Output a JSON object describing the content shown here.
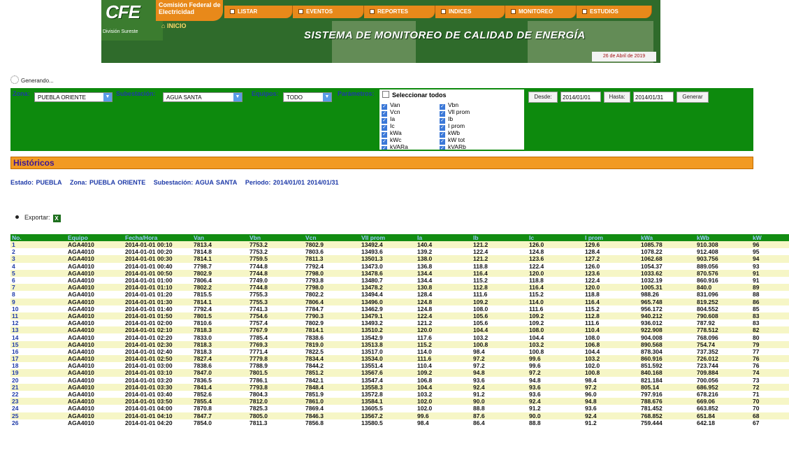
{
  "header": {
    "logo": "CFE",
    "org_name": "Comisión Federal de Electricidad",
    "division": "División Sureste",
    "home_link": "INICIO",
    "nav": [
      "LISTAR",
      "EVENTOS",
      "REPORTES",
      "INDICES",
      "MONITOREO",
      "ESTUDIOS"
    ],
    "title": "SISTEMA DE MONITOREO DE CALIDAD DE ENERGÍA",
    "date": "26 de Abril de 2019"
  },
  "status": "Generando...",
  "filters": {
    "zona_label": "Zona:",
    "zona_value": "PUEBLA ORIENTE",
    "subestacion_label": "Subestación:",
    "subestacion_value": "AGUA SANTA",
    "equipos_label": "Equipos:",
    "equipos_value": "TODO",
    "parametros_label": "Parámetros:",
    "select_all": "Seleccionar todos",
    "params_left": [
      "Van",
      "Vcn",
      "Ia",
      "Ic",
      "kWa",
      "kWc",
      "kVARa"
    ],
    "params_right": [
      "Vbn",
      "Vll prom",
      "Ib",
      "I prom",
      "kWb",
      "kW tot",
      "kVARb"
    ],
    "desde_label": "Desde:",
    "desde_value": "2014/01/01",
    "hasta_label": "Hasta:",
    "hasta_value": "2014/01/31",
    "generar_label": "Generar"
  },
  "section_title": "Históricos",
  "summary": {
    "estado": "Estado: PUEBLA",
    "zona": "Zona: PUEBLA ORIENTE",
    "subestacion": "Subestación: AGUA SANTA",
    "periodo": "Periodo:  2014/01/01  2014/01/31"
  },
  "export_label": "Exportar:",
  "table": {
    "columns": [
      "No.",
      "Equipo",
      "Fecha/Hora",
      "Van",
      "Vbn",
      "Vcn",
      "Vll prom",
      "Ia",
      "Ib",
      "Ic",
      "I prom",
      "kWa",
      "kWb",
      "kW"
    ],
    "rows": [
      [
        "1",
        "AGA4010",
        "2014-01-01 00:10",
        "7813.4",
        "7753.2",
        "7802.9",
        "13492.4",
        "140.4",
        "121.2",
        "126.0",
        "129.6",
        "1085.78",
        "910.308",
        "96"
      ],
      [
        "2",
        "AGA4010",
        "2014-01-01 00:20",
        "7814.8",
        "7753.2",
        "7803.6",
        "13493.6",
        "139.2",
        "122.4",
        "124.8",
        "128.4",
        "1078.22",
        "912.408",
        "95"
      ],
      [
        "3",
        "AGA4010",
        "2014-01-01 00:30",
        "7814.1",
        "7759.5",
        "7811.3",
        "13501.3",
        "138.0",
        "121.2",
        "123.6",
        "127.2",
        "1062.68",
        "903.756",
        "94"
      ],
      [
        "4",
        "AGA4010",
        "2014-01-01 00:40",
        "7798.7",
        "7744.8",
        "7792.4",
        "13473.0",
        "136.8",
        "118.8",
        "122.4",
        "126.0",
        "1054.37",
        "889.056",
        "93"
      ],
      [
        "5",
        "AGA4010",
        "2014-01-01 00:50",
        "7802.9",
        "7744.8",
        "7798.0",
        "13478.6",
        "134.4",
        "116.4",
        "120.0",
        "123.6",
        "1033.62",
        "870.576",
        "91"
      ],
      [
        "6",
        "AGA4010",
        "2014-01-01 01:00",
        "7806.4",
        "7749.0",
        "7793.8",
        "13480.7",
        "134.4",
        "115.2",
        "118.8",
        "122.4",
        "1032.19",
        "860.916",
        "91"
      ],
      [
        "7",
        "AGA4010",
        "2014-01-01 01:10",
        "7802.2",
        "7744.8",
        "7798.0",
        "13478.2",
        "130.8",
        "112.8",
        "116.4",
        "120.0",
        "1005.31",
        "840.0",
        "89"
      ],
      [
        "8",
        "AGA4010",
        "2014-01-01 01:20",
        "7815.5",
        "7755.3",
        "7802.2",
        "13494.4",
        "128.4",
        "111.6",
        "115.2",
        "118.8",
        "988.26",
        "831.096",
        "88"
      ],
      [
        "9",
        "AGA4010",
        "2014-01-01 01:30",
        "7814.1",
        "7755.3",
        "7806.4",
        "13496.0",
        "124.8",
        "109.2",
        "114.0",
        "116.4",
        "965.748",
        "819.252",
        "86"
      ],
      [
        "10",
        "AGA4010",
        "2014-01-01 01:40",
        "7792.4",
        "7741.3",
        "7784.7",
        "13462.9",
        "124.8",
        "108.0",
        "111.6",
        "115.2",
        "956.172",
        "804.552",
        "85"
      ],
      [
        "11",
        "AGA4010",
        "2014-01-01 01:50",
        "7801.5",
        "7754.6",
        "7790.3",
        "13479.1",
        "122.4",
        "105.6",
        "109.2",
        "112.8",
        "940.212",
        "790.608",
        "83"
      ],
      [
        "12",
        "AGA4010",
        "2014-01-01 02:00",
        "7810.6",
        "7757.4",
        "7802.9",
        "13493.2",
        "121.2",
        "105.6",
        "109.2",
        "111.6",
        "936.012",
        "787.92",
        "83"
      ],
      [
        "13",
        "AGA4010",
        "2014-01-01 02:10",
        "7818.3",
        "7767.9",
        "7814.1",
        "13510.2",
        "120.0",
        "104.4",
        "108.0",
        "110.4",
        "922.908",
        "778.512",
        "82"
      ],
      [
        "14",
        "AGA4010",
        "2014-01-01 02:20",
        "7833.0",
        "7785.4",
        "7838.6",
        "13542.9",
        "117.6",
        "103.2",
        "104.4",
        "108.0",
        "904.008",
        "768.096",
        "80"
      ],
      [
        "15",
        "AGA4010",
        "2014-01-01 02:30",
        "7818.3",
        "7769.3",
        "7819.0",
        "13513.8",
        "115.2",
        "100.8",
        "103.2",
        "106.8",
        "890.568",
        "754.74",
        "79"
      ],
      [
        "16",
        "AGA4010",
        "2014-01-01 02:40",
        "7818.3",
        "7771.4",
        "7822.5",
        "13517.0",
        "114.0",
        "98.4",
        "100.8",
        "104.4",
        "878.304",
        "737.352",
        "77"
      ],
      [
        "17",
        "AGA4010",
        "2014-01-01 02:50",
        "7827.4",
        "7779.8",
        "7834.4",
        "13534.0",
        "111.6",
        "97.2",
        "99.6",
        "103.2",
        "860.916",
        "726.012",
        "76"
      ],
      [
        "18",
        "AGA4010",
        "2014-01-01 03:00",
        "7838.6",
        "7788.9",
        "7844.2",
        "13551.4",
        "110.4",
        "97.2",
        "99.6",
        "102.0",
        "851.592",
        "723.744",
        "76"
      ],
      [
        "19",
        "AGA4010",
        "2014-01-01 03:10",
        "7847.0",
        "7801.5",
        "7851.2",
        "13567.6",
        "109.2",
        "94.8",
        "97.2",
        "100.8",
        "840.168",
        "709.884",
        "74"
      ],
      [
        "20",
        "AGA4010",
        "2014-01-01 03:20",
        "7836.5",
        "7786.1",
        "7842.1",
        "13547.4",
        "106.8",
        "93.6",
        "94.8",
        "98.4",
        "821.184",
        "700.056",
        "73"
      ],
      [
        "21",
        "AGA4010",
        "2014-01-01 03:30",
        "7841.4",
        "7793.8",
        "7848.4",
        "13558.3",
        "104.4",
        "92.4",
        "93.6",
        "97.2",
        "805.14",
        "686.952",
        "72"
      ],
      [
        "22",
        "AGA4010",
        "2014-01-01 03:40",
        "7852.6",
        "7804.3",
        "7851.9",
        "13572.8",
        "103.2",
        "91.2",
        "93.6",
        "96.0",
        "797.916",
        "678.216",
        "71"
      ],
      [
        "23",
        "AGA4010",
        "2014-01-01 03:50",
        "7855.4",
        "7812.0",
        "7861.0",
        "13584.1",
        "102.0",
        "90.0",
        "92.4",
        "94.8",
        "788.676",
        "669.06",
        "70"
      ],
      [
        "24",
        "AGA4010",
        "2014-01-01 04:00",
        "7870.8",
        "7825.3",
        "7869.4",
        "13605.5",
        "102.0",
        "88.8",
        "91.2",
        "93.6",
        "781.452",
        "663.852",
        "70"
      ],
      [
        "25",
        "AGA4010",
        "2014-01-01 04:10",
        "7847.7",
        "7805.0",
        "7846.3",
        "13567.2",
        "99.6",
        "87.6",
        "90.0",
        "92.4",
        "768.852",
        "651.84",
        "68"
      ],
      [
        "26",
        "AGA4010",
        "2014-01-01 04:20",
        "7854.0",
        "7811.3",
        "7856.8",
        "13580.5",
        "98.4",
        "86.4",
        "88.8",
        "91.2",
        "759.444",
        "642.18",
        "67"
      ]
    ]
  },
  "colors": {
    "banner_green": "#2f6b2b",
    "nav_orange": "#e8891a",
    "filter_green": "#0d8a0d",
    "label_blue": "#1e3aa8",
    "section_orange": "#f29a22",
    "row_stripe": "#f6f6c6"
  }
}
